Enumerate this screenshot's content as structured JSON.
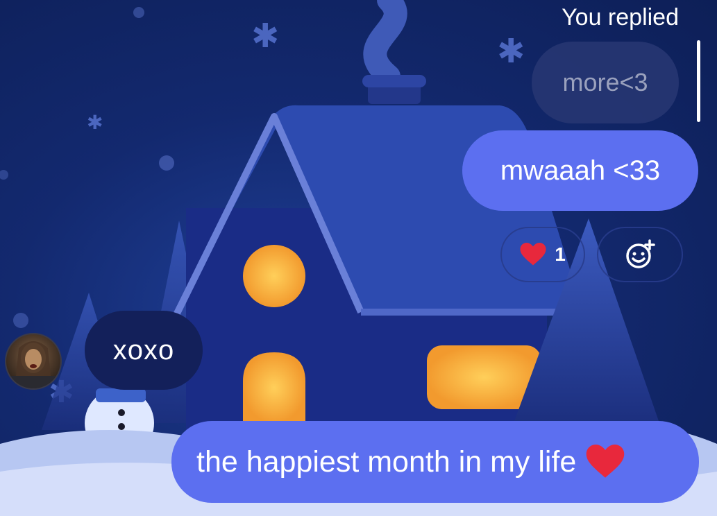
{
  "thread": {
    "reply_label": "You replied",
    "replied_to_text": "more<3",
    "messages": {
      "sent_1": "mwaaah <33",
      "received_1": "xoxo",
      "sent_2": "the happiest month in my life"
    },
    "reaction": {
      "emoji": "heart",
      "count": "1"
    }
  },
  "icons": {
    "heart": "heart-icon",
    "add_reaction": "add-reaction-icon",
    "avatar": "user-avatar"
  },
  "colors": {
    "sent_bubble": "#5c6ff0",
    "received_bubble": "#13205a",
    "heart": "#e8283c",
    "background": "#13296f"
  }
}
